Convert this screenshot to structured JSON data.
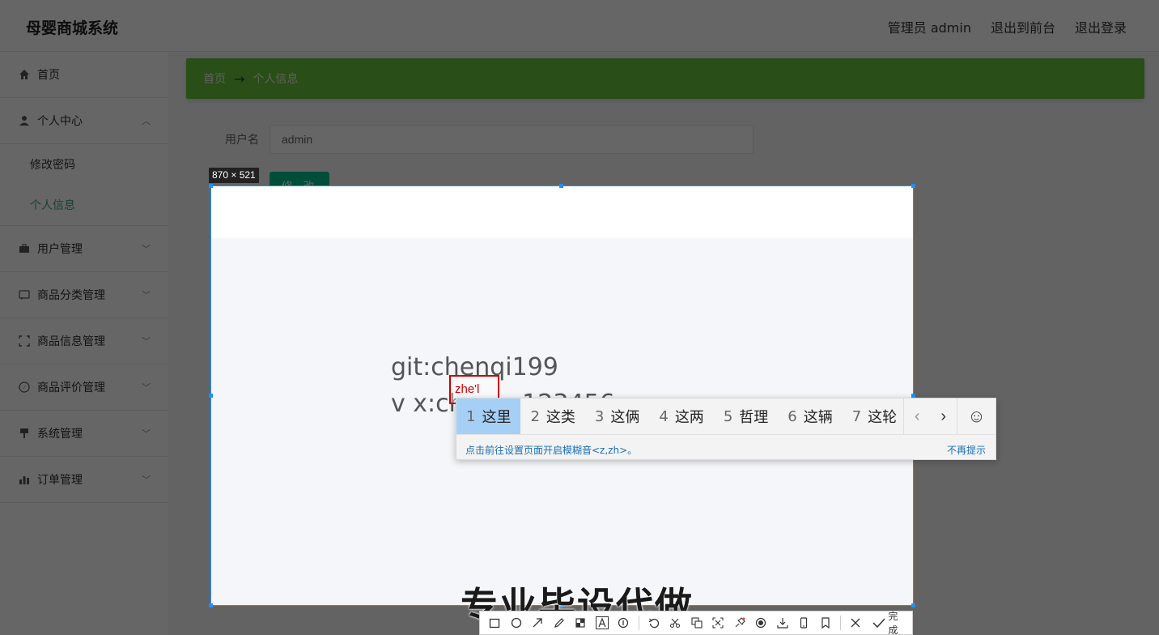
{
  "header": {
    "brand": "母婴商城系统",
    "admin_label": "管理员 admin",
    "to_frontend": "退出到前台",
    "logout": "退出登录"
  },
  "sidebar": {
    "home": "首页",
    "personal_center": "个人中心",
    "change_password": "修改密码",
    "personal_info": "个人信息",
    "user_mgmt": "用户管理",
    "category_mgmt": "商品分类管理",
    "product_mgmt": "商品信息管理",
    "review_mgmt": "商品评价管理",
    "system_mgmt": "系统管理",
    "order_mgmt": "订单管理"
  },
  "breadcrumb": {
    "home": "首页",
    "arrow": "→",
    "current": "个人信息"
  },
  "form": {
    "username_label": "用户名",
    "username_value": "admin",
    "edit_button": "修 改"
  },
  "capture": {
    "size_label": "870 × 521",
    "line1": "git:chenqi199",
    "line2": "v x:chen_q123456",
    "watermark": "专业毕设代做"
  },
  "ime": {
    "composition": "zhe'l",
    "candidates": [
      {
        "num": "1",
        "text": "这里"
      },
      {
        "num": "2",
        "text": "这类"
      },
      {
        "num": "3",
        "text": "这俩"
      },
      {
        "num": "4",
        "text": "这两"
      },
      {
        "num": "5",
        "text": "哲理"
      },
      {
        "num": "6",
        "text": "这辆"
      },
      {
        "num": "7",
        "text": "这轮"
      }
    ],
    "hint": "点击前往设置页面开启模糊音<z,zh>。",
    "dismiss": "不再提示"
  },
  "toolbar": {
    "done_label": "完成",
    "icons": [
      "rectangle-icon",
      "ellipse-icon",
      "arrow-icon",
      "pen-icon",
      "mosaic-icon",
      "text-icon",
      "number-icon",
      "undo-icon",
      "crop-icon",
      "pin-icon",
      "ocr-icon",
      "pin-top-icon",
      "record-icon",
      "download-icon",
      "phone-icon",
      "bookmark-icon"
    ]
  }
}
